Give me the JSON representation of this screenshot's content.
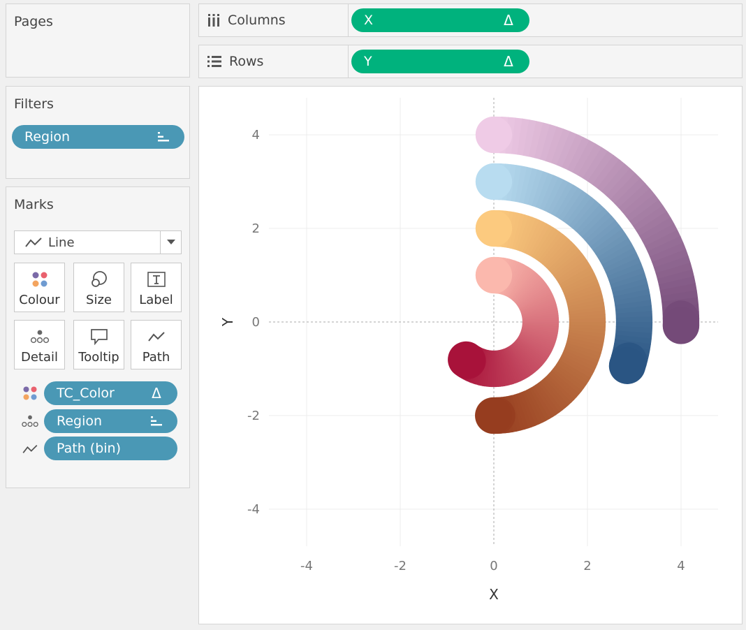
{
  "pages": {
    "title": "Pages"
  },
  "filters": {
    "title": "Filters",
    "pill": {
      "label": "Region",
      "icon": "dimension-discrete-icon"
    }
  },
  "marks": {
    "title": "Marks",
    "mark_type": "Line",
    "buttons": [
      {
        "label": "Colour",
        "icon": "colour-dots-icon"
      },
      {
        "label": "Size",
        "icon": "size-circles-icon"
      },
      {
        "label": "Label",
        "icon": "label-text-icon"
      },
      {
        "label": "Detail",
        "icon": "detail-dots-icon"
      },
      {
        "label": "Tooltip",
        "icon": "tooltip-bubble-icon"
      },
      {
        "label": "Path",
        "icon": "path-line-icon"
      }
    ],
    "fields": [
      {
        "label": "TC_Color",
        "encoding": "colour",
        "badge": "Δ"
      },
      {
        "label": "Region",
        "encoding": "detail",
        "badge": "dimension-discrete-icon"
      },
      {
        "label": "Path (bin)",
        "encoding": "path",
        "badge": ""
      }
    ]
  },
  "shelves": {
    "columns": {
      "label": "Columns",
      "pill": "X",
      "badge": "Δ"
    },
    "rows": {
      "label": "Rows",
      "pill": "Y",
      "badge": "Δ"
    }
  },
  "chart_data": {
    "type": "line",
    "description_kind": "radial arcs drawn as thick gradient lines",
    "xlabel": "X",
    "ylabel": "Y",
    "xlim": [
      -4.8,
      4.8
    ],
    "ylim": [
      -4.8,
      4.8
    ],
    "x_ticks": [
      -4,
      -2,
      0,
      2,
      4
    ],
    "y_ticks": [
      4,
      2,
      0,
      -2,
      -4
    ],
    "grid": true,
    "zero_lines": "dashed",
    "series": [
      {
        "radius": 4.0,
        "start_deg": 90,
        "end_deg": 181,
        "color_start": "#efcbe6",
        "color_end": "#744a78"
      },
      {
        "radius": 3.0,
        "start_deg": 90,
        "end_deg": 198,
        "color_start": "#b8dcf0",
        "color_end": "#2a5583"
      },
      {
        "radius": 2.0,
        "start_deg": 90,
        "end_deg": 270,
        "color_start": "#fcca7f",
        "color_end": "#963d1f"
      },
      {
        "radius": 1.0,
        "start_deg": 90,
        "end_deg": 306,
        "color_start": "#fbb8ad",
        "color_end": "#a8123a"
      }
    ],
    "line_width_units": 0.78
  }
}
